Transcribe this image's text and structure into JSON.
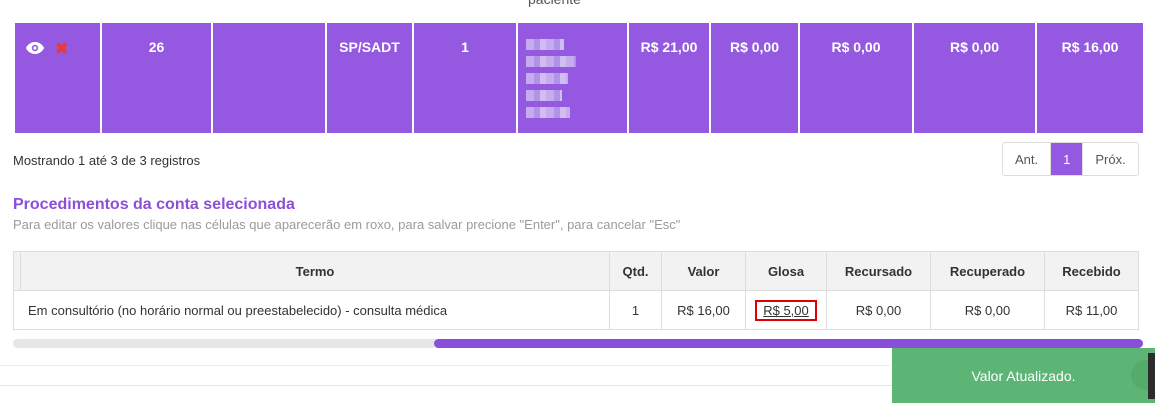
{
  "header_cut": "paciente",
  "accounts_row": {
    "id": "26",
    "col3": "",
    "tipo": "SP/SADT",
    "qtd": "1",
    "valor": "R$ 21,00",
    "col7": "R$ 0,00",
    "col8": "R$ 0,00",
    "col9": "R$ 0,00",
    "col10": "R$ 16,00"
  },
  "showing_text": "Mostrando 1 até 3 de 3 registros",
  "pagination": {
    "prev": "Ant.",
    "current": "1",
    "next": "Próx."
  },
  "procedures": {
    "title": "Procedimentos da conta selecionada",
    "help": "Para editar os valores clique nas células que aparecerão em roxo, para salvar precione \"Enter\", para cancelar \"Esc\"",
    "headers": [
      "",
      "Termo",
      "Qtd.",
      "Valor",
      "Glosa",
      "Recursado",
      "Recuperado",
      "Recebido"
    ],
    "rows": [
      {
        "termo": "Em consultório (no horário normal ou preestabelecido) - consulta médica",
        "qtd": "1",
        "valor": "R$ 16,00",
        "glosa": "R$ 5,00",
        "recursado": "R$ 0,00",
        "recuperado": "R$ 0,00",
        "recebido": "R$ 11,00"
      }
    ]
  },
  "toast": {
    "message": "Valor Atualizado."
  },
  "colors": {
    "accent": "#9459e0",
    "toast": "#5cb574",
    "highlight": "#e00000"
  },
  "icons": {
    "view": "eye-icon",
    "delete": "x-icon"
  }
}
